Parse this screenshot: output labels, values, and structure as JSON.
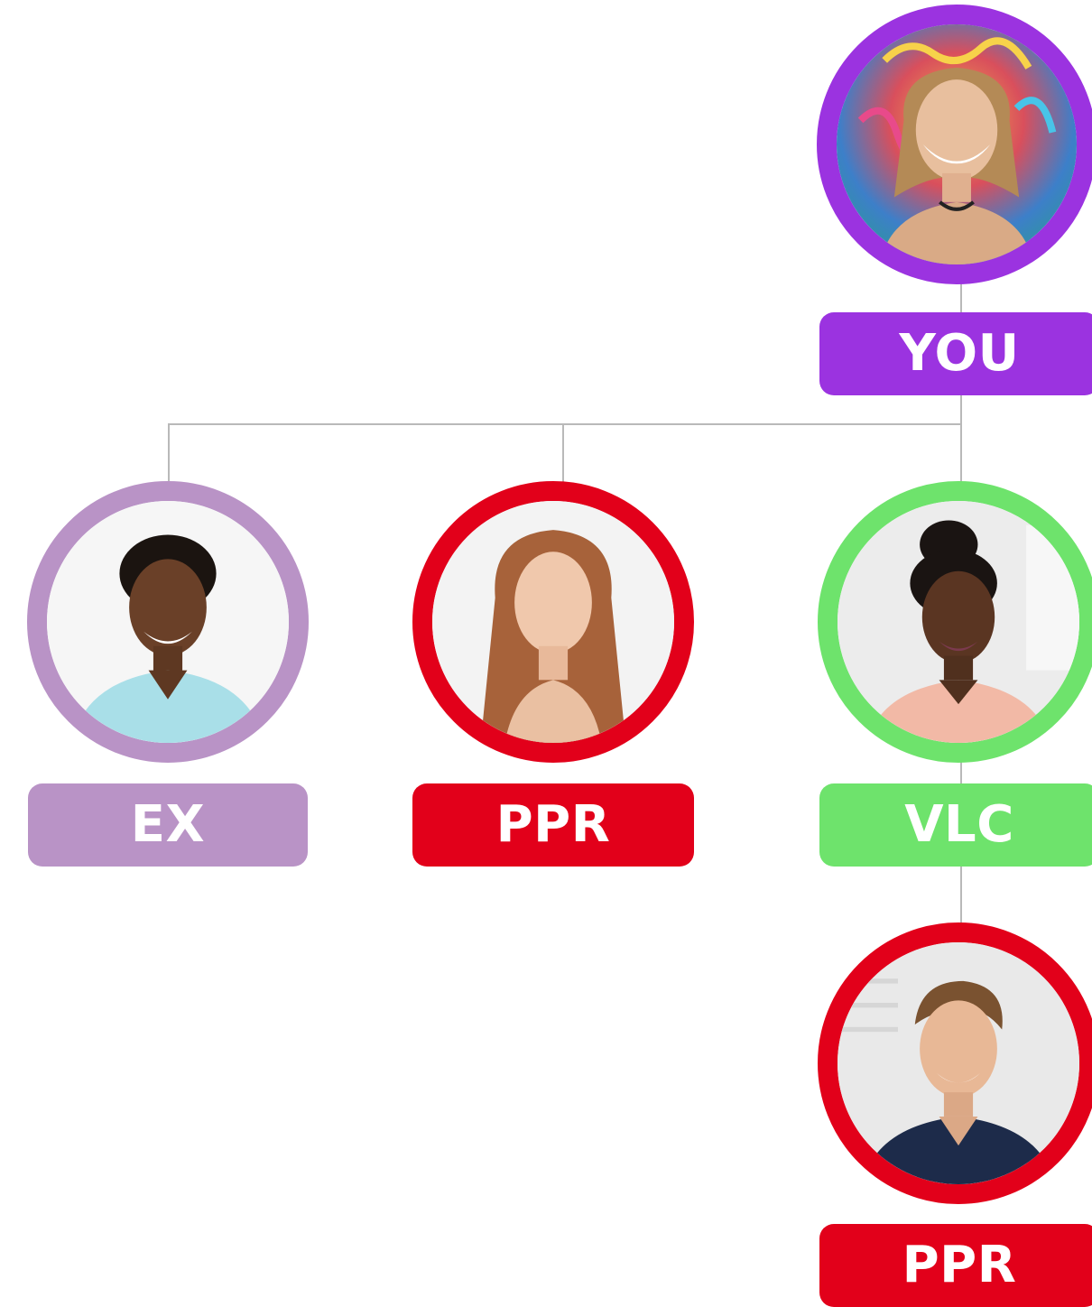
{
  "colors": {
    "you": "#9b33e0",
    "ex": "#b993c6",
    "ppr": "#e2001a",
    "vlc": "#6ee36c",
    "connector": "#b9b9b9"
  },
  "nodes": {
    "you": {
      "label": "YOU",
      "avatar": "woman-with-wavy-blonde-hair-portrait"
    },
    "ex": {
      "label": "EX",
      "avatar": "man-in-light-blue-tshirt-portrait"
    },
    "ppr_top": {
      "label": "PPR",
      "avatar": "woman-with-long-auburn-hair-portrait"
    },
    "vlc": {
      "label": "VLC",
      "avatar": "woman-with-hair-bun-portrait"
    },
    "ppr_bottom": {
      "label": "PPR",
      "avatar": "man-in-navy-polo-portrait"
    }
  }
}
